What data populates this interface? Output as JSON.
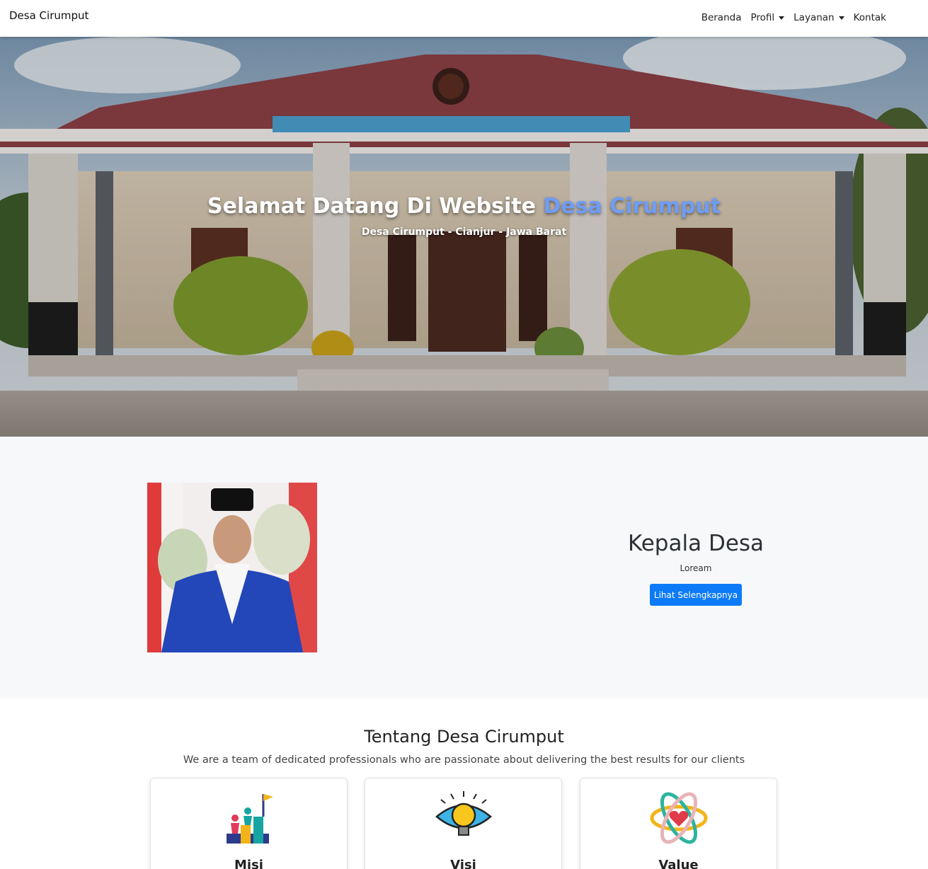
{
  "navbar": {
    "brand": "Desa Cirumput",
    "items": [
      {
        "label": "Beranda",
        "dropdown": false
      },
      {
        "label": "Profil",
        "dropdown": true
      },
      {
        "label": "Layanan",
        "dropdown": true
      },
      {
        "label": "Kontak",
        "dropdown": false
      }
    ]
  },
  "hero": {
    "title_prefix": "Selamat Datang Di Website ",
    "title_accent": "Desa Cirumput",
    "subtitle": "Desa Cirumput - Cianjur - Jawa Barat",
    "accent_color": "#6f9cf5"
  },
  "kepala_desa": {
    "title": "Kepala Desa",
    "description": "Loream",
    "button_label": "Lihat Selengkapnya",
    "button_color": "#0d7bf7"
  },
  "about": {
    "title": "Tentang Desa Cirumput",
    "subtitle": "We are a team of dedicated professionals who are passionate about delivering the best results for our clients",
    "cards": [
      {
        "title": "Misi",
        "icon": "team-goal-flag-icon"
      },
      {
        "title": "Visi",
        "icon": "eye-lightbulb-icon"
      },
      {
        "title": "Value",
        "icon": "atom-heart-icon"
      }
    ]
  }
}
